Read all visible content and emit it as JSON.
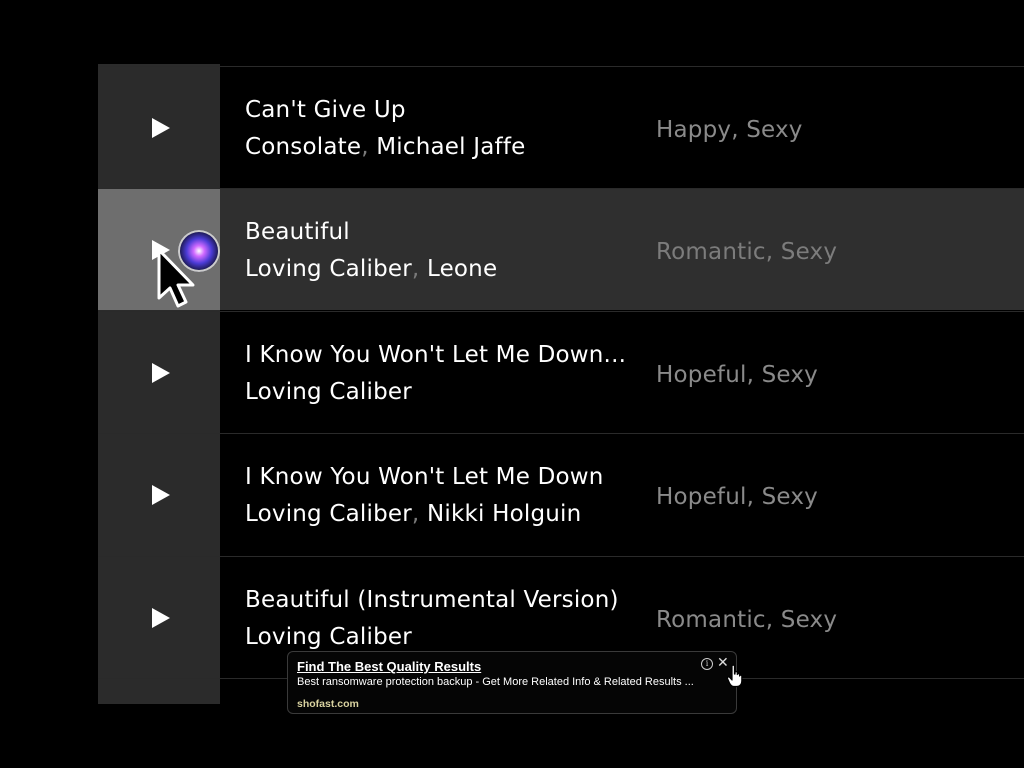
{
  "tracks": [
    {
      "title": "Can't Give Up",
      "artists": [
        "Consolate",
        "Michael Jaffe"
      ],
      "moods": "Happy, Sexy",
      "active": false
    },
    {
      "title": "Beautiful",
      "artists": [
        "Loving Caliber",
        "Leone"
      ],
      "moods": "Romantic, Sexy",
      "active": true
    },
    {
      "title": "I Know You Won't Let Me Down...",
      "artists": [
        "Loving Caliber"
      ],
      "moods": "Hopeful, Sexy",
      "active": false
    },
    {
      "title": "I Know You Won't Let Me Down",
      "artists": [
        "Loving Caliber",
        "Nikki Holguin"
      ],
      "moods": "Hopeful, Sexy",
      "active": false
    },
    {
      "title": "Beautiful (Instrumental Version)",
      "artists": [
        "Loving Caliber"
      ],
      "moods": "Romantic, Sexy",
      "active": false
    }
  ],
  "artist_separator": ", ",
  "icons": {
    "play": "play-icon",
    "badge": "siri-orb-icon",
    "pointer": "arrow-cursor-icon",
    "hand": "hand-cursor-icon",
    "info": "info-icon",
    "close": "close-icon"
  },
  "ad": {
    "title": "Find The Best Quality Results",
    "description": "Best ransomware protection backup - Get More Related Info & Related Results ...",
    "domain": "shofast.com",
    "info_glyph": "i",
    "close_glyph": "✕"
  },
  "colors": {
    "background": "#000000",
    "play_column": "#2b2b2b",
    "active_row": "#2f2f2f",
    "active_play_cell": "#6e6e6e",
    "title_text": "#ffffff",
    "mood_text": "#8a8a8a",
    "ad_domain": "#d9d2a0"
  }
}
